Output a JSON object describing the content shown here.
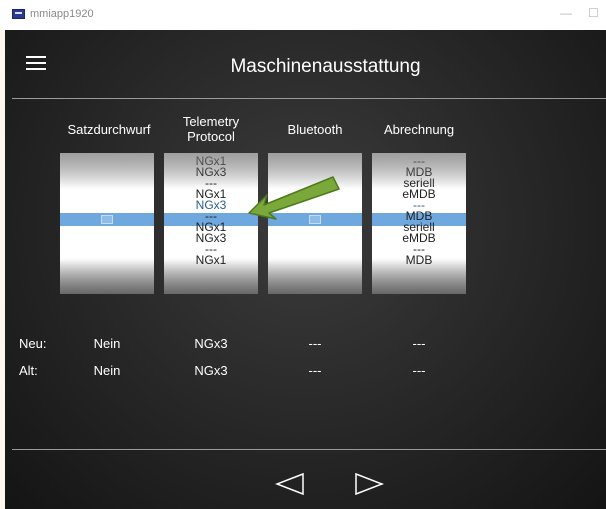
{
  "window": {
    "title": "mmiapp1920",
    "minimize_glyph": "—",
    "maximize_glyph": "☐"
  },
  "header": {
    "menu_icon": "hamburger-icon",
    "title": "Maschinenausstattung"
  },
  "columns": [
    {
      "label": "Satzdurchwurf",
      "items": [],
      "selected": ""
    },
    {
      "label": "Telemetry\nProtocol",
      "items": [
        "NGx1",
        "NGx3",
        "---",
        "NGx1",
        "NGx3",
        "---",
        "NGx1",
        "NGx3",
        "---",
        "NGx1"
      ],
      "selected": "NGx3"
    },
    {
      "label": "Bluetooth",
      "items": [],
      "selected": ""
    },
    {
      "label": "Abrechnung",
      "items": [
        "---",
        "MDB",
        "seriell",
        "eMDB",
        "---",
        "MDB",
        "seriell",
        "eMDB",
        "---",
        "MDB"
      ],
      "selected": "---"
    }
  ],
  "rows": {
    "neu": {
      "label": "Neu:",
      "values": [
        "Nein",
        "NGx3",
        "---",
        "---"
      ]
    },
    "alt": {
      "label": "Alt:",
      "values": [
        "Nein",
        "NGx3",
        "---",
        "---"
      ]
    }
  },
  "navigation": {
    "prev_icon": "triangle-left-icon",
    "next_icon": "triangle-right-icon"
  },
  "colors": {
    "selection_band": "#6ea8de",
    "annotation_arrow": "#7aa83a"
  }
}
